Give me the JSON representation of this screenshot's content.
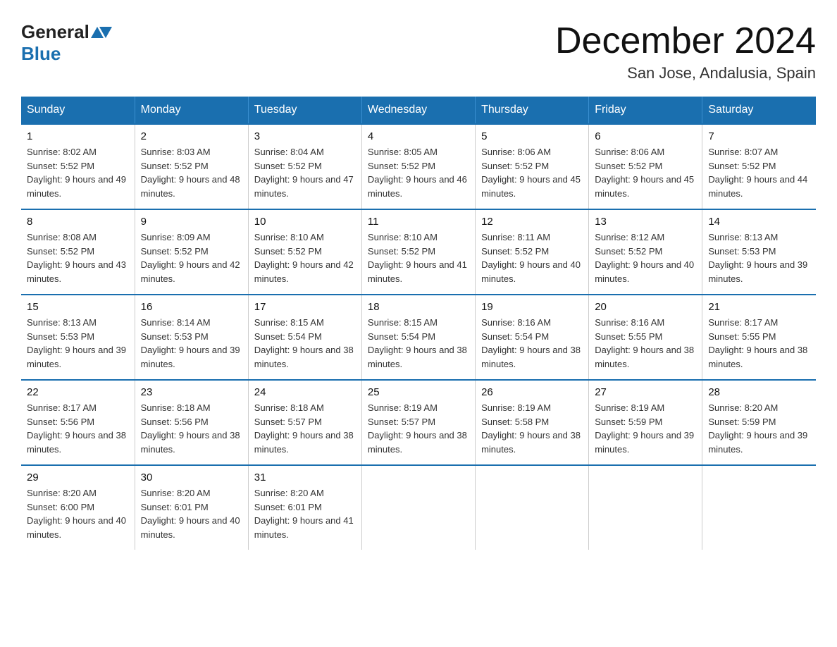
{
  "logo": {
    "general": "General",
    "blue": "Blue"
  },
  "title": "December 2024",
  "subtitle": "San Jose, Andalusia, Spain",
  "headers": [
    "Sunday",
    "Monday",
    "Tuesday",
    "Wednesday",
    "Thursday",
    "Friday",
    "Saturday"
  ],
  "weeks": [
    [
      {
        "day": "1",
        "sunrise": "8:02 AM",
        "sunset": "5:52 PM",
        "daylight": "9 hours and 49 minutes."
      },
      {
        "day": "2",
        "sunrise": "8:03 AM",
        "sunset": "5:52 PM",
        "daylight": "9 hours and 48 minutes."
      },
      {
        "day": "3",
        "sunrise": "8:04 AM",
        "sunset": "5:52 PM",
        "daylight": "9 hours and 47 minutes."
      },
      {
        "day": "4",
        "sunrise": "8:05 AM",
        "sunset": "5:52 PM",
        "daylight": "9 hours and 46 minutes."
      },
      {
        "day": "5",
        "sunrise": "8:06 AM",
        "sunset": "5:52 PM",
        "daylight": "9 hours and 45 minutes."
      },
      {
        "day": "6",
        "sunrise": "8:06 AM",
        "sunset": "5:52 PM",
        "daylight": "9 hours and 45 minutes."
      },
      {
        "day": "7",
        "sunrise": "8:07 AM",
        "sunset": "5:52 PM",
        "daylight": "9 hours and 44 minutes."
      }
    ],
    [
      {
        "day": "8",
        "sunrise": "8:08 AM",
        "sunset": "5:52 PM",
        "daylight": "9 hours and 43 minutes."
      },
      {
        "day": "9",
        "sunrise": "8:09 AM",
        "sunset": "5:52 PM",
        "daylight": "9 hours and 42 minutes."
      },
      {
        "day": "10",
        "sunrise": "8:10 AM",
        "sunset": "5:52 PM",
        "daylight": "9 hours and 42 minutes."
      },
      {
        "day": "11",
        "sunrise": "8:10 AM",
        "sunset": "5:52 PM",
        "daylight": "9 hours and 41 minutes."
      },
      {
        "day": "12",
        "sunrise": "8:11 AM",
        "sunset": "5:52 PM",
        "daylight": "9 hours and 40 minutes."
      },
      {
        "day": "13",
        "sunrise": "8:12 AM",
        "sunset": "5:52 PM",
        "daylight": "9 hours and 40 minutes."
      },
      {
        "day": "14",
        "sunrise": "8:13 AM",
        "sunset": "5:53 PM",
        "daylight": "9 hours and 39 minutes."
      }
    ],
    [
      {
        "day": "15",
        "sunrise": "8:13 AM",
        "sunset": "5:53 PM",
        "daylight": "9 hours and 39 minutes."
      },
      {
        "day": "16",
        "sunrise": "8:14 AM",
        "sunset": "5:53 PM",
        "daylight": "9 hours and 39 minutes."
      },
      {
        "day": "17",
        "sunrise": "8:15 AM",
        "sunset": "5:54 PM",
        "daylight": "9 hours and 38 minutes."
      },
      {
        "day": "18",
        "sunrise": "8:15 AM",
        "sunset": "5:54 PM",
        "daylight": "9 hours and 38 minutes."
      },
      {
        "day": "19",
        "sunrise": "8:16 AM",
        "sunset": "5:54 PM",
        "daylight": "9 hours and 38 minutes."
      },
      {
        "day": "20",
        "sunrise": "8:16 AM",
        "sunset": "5:55 PM",
        "daylight": "9 hours and 38 minutes."
      },
      {
        "day": "21",
        "sunrise": "8:17 AM",
        "sunset": "5:55 PM",
        "daylight": "9 hours and 38 minutes."
      }
    ],
    [
      {
        "day": "22",
        "sunrise": "8:17 AM",
        "sunset": "5:56 PM",
        "daylight": "9 hours and 38 minutes."
      },
      {
        "day": "23",
        "sunrise": "8:18 AM",
        "sunset": "5:56 PM",
        "daylight": "9 hours and 38 minutes."
      },
      {
        "day": "24",
        "sunrise": "8:18 AM",
        "sunset": "5:57 PM",
        "daylight": "9 hours and 38 minutes."
      },
      {
        "day": "25",
        "sunrise": "8:19 AM",
        "sunset": "5:57 PM",
        "daylight": "9 hours and 38 minutes."
      },
      {
        "day": "26",
        "sunrise": "8:19 AM",
        "sunset": "5:58 PM",
        "daylight": "9 hours and 38 minutes."
      },
      {
        "day": "27",
        "sunrise": "8:19 AM",
        "sunset": "5:59 PM",
        "daylight": "9 hours and 39 minutes."
      },
      {
        "day": "28",
        "sunrise": "8:20 AM",
        "sunset": "5:59 PM",
        "daylight": "9 hours and 39 minutes."
      }
    ],
    [
      {
        "day": "29",
        "sunrise": "8:20 AM",
        "sunset": "6:00 PM",
        "daylight": "9 hours and 40 minutes."
      },
      {
        "day": "30",
        "sunrise": "8:20 AM",
        "sunset": "6:01 PM",
        "daylight": "9 hours and 40 minutes."
      },
      {
        "day": "31",
        "sunrise": "8:20 AM",
        "sunset": "6:01 PM",
        "daylight": "9 hours and 41 minutes."
      },
      null,
      null,
      null,
      null
    ]
  ]
}
